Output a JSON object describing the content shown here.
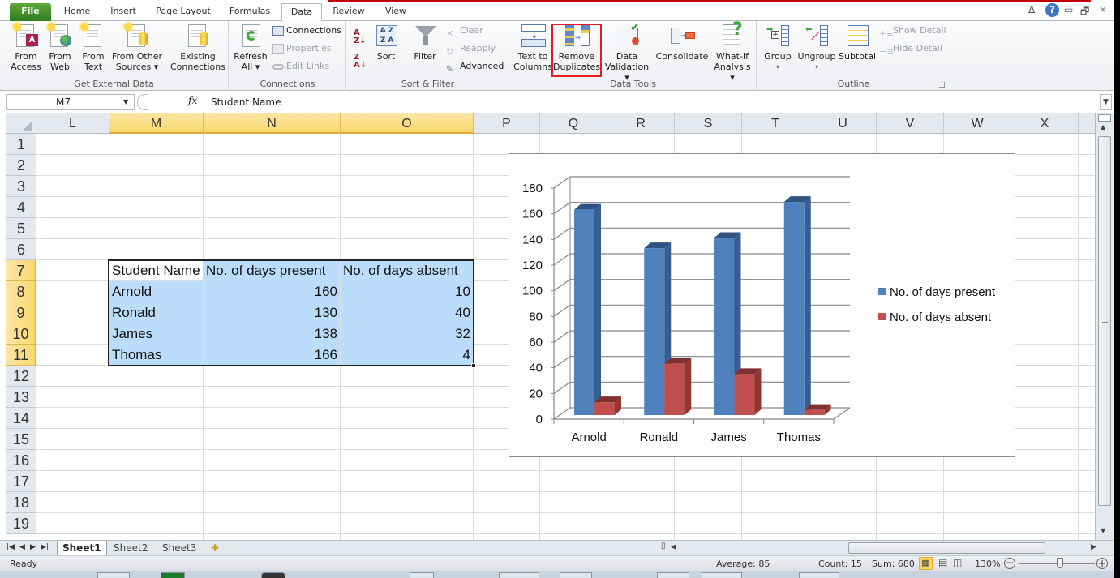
{
  "window": {
    "minimize_icon": "▭",
    "restore_icon": "🗗",
    "close_icon": "✕",
    "collapse_ribbon_icon": "ᐃ",
    "help_icon": "?"
  },
  "tabs": [
    {
      "label": "File"
    },
    {
      "label": "Home"
    },
    {
      "label": "Insert"
    },
    {
      "label": "Page Layout"
    },
    {
      "label": "Formulas"
    },
    {
      "label": "Data",
      "active": true
    },
    {
      "label": "Review"
    },
    {
      "label": "View"
    }
  ],
  "ribbon": {
    "groups": {
      "get_external_data": {
        "label": "Get External Data",
        "from_access": [
          "From",
          "Access"
        ],
        "from_web": [
          "From",
          "Web"
        ],
        "from_text": [
          "From",
          "Text"
        ],
        "from_other_sources": [
          "From Other",
          "Sources ▾"
        ],
        "existing_connections": [
          "Existing",
          "Connections"
        ]
      },
      "connections": {
        "label": "Connections",
        "refresh_all": [
          "Refresh",
          "All ▾"
        ],
        "connections": "Connections",
        "properties": "Properties",
        "edit_links": "Edit Links"
      },
      "sort_filter": {
        "label": "Sort & Filter",
        "sort_az": "A→Z",
        "sort_za": "Z→A",
        "sort": "Sort",
        "filter": "Filter",
        "clear": "Clear",
        "reapply": "Reapply",
        "advanced": "Advanced"
      },
      "data_tools": {
        "label": "Data Tools",
        "text_to_columns": [
          "Text to",
          "Columns"
        ],
        "remove_duplicates": [
          "Remove",
          "Duplicates"
        ],
        "data_validation": [
          "Data",
          "Validation ▾"
        ],
        "consolidate": [
          "Consolidate",
          ""
        ],
        "what_if": [
          "What-If",
          "Analysis ▾"
        ]
      },
      "outline": {
        "label": "Outline",
        "group": [
          "Group",
          "▾"
        ],
        "ungroup": [
          "Ungroup",
          "▾"
        ],
        "subtotal": [
          "Subtotal",
          ""
        ],
        "show_detail": "Show Detail",
        "hide_detail": "Hide Detail"
      }
    }
  },
  "formula_bar": {
    "name_box": "M7",
    "fx": "fx",
    "value": "Student Name"
  },
  "columns": [
    "L",
    "M",
    "N",
    "O",
    "P",
    "Q",
    "R",
    "S",
    "T",
    "U",
    "V",
    "W",
    "X"
  ],
  "selected_columns": [
    "M",
    "N",
    "O"
  ],
  "rows": [
    "1",
    "2",
    "3",
    "4",
    "5",
    "6",
    "7",
    "8",
    "9",
    "10",
    "11",
    "12",
    "13",
    "14",
    "15",
    "16",
    "17",
    "18",
    "19"
  ],
  "selected_rows": [
    "7",
    "8",
    "9",
    "10",
    "11"
  ],
  "table": {
    "headers": [
      "Student Name",
      "No. of days present",
      "No. of days absent"
    ],
    "rows": [
      [
        "Arnold",
        "160",
        "10"
      ],
      [
        "Ronald",
        "130",
        "40"
      ],
      [
        "James",
        "138",
        "32"
      ],
      [
        "Thomas",
        "166",
        "4"
      ]
    ]
  },
  "chart_data": {
    "type": "bar",
    "subtype": "3d-clustered-column",
    "title": "",
    "categories": [
      "Arnold",
      "Ronald",
      "James",
      "Thomas"
    ],
    "series": [
      {
        "name": "No. of days present",
        "values": [
          160,
          130,
          138,
          166
        ],
        "color": "#4f81bd"
      },
      {
        "name": "No. of days absent",
        "values": [
          10,
          40,
          32,
          4
        ],
        "color": "#c0504d"
      }
    ],
    "xlabel": "",
    "ylabel": "",
    "ylim": [
      0,
      180
    ],
    "yticks": [
      0,
      20,
      40,
      60,
      80,
      100,
      120,
      140,
      160,
      180
    ],
    "grid": true,
    "legend": "right"
  },
  "sheets": [
    {
      "label": "Sheet1",
      "active": true
    },
    {
      "label": "Sheet2"
    },
    {
      "label": "Sheet3"
    }
  ],
  "status": {
    "ready": "Ready",
    "average": "Average: 85",
    "count": "Count: 15",
    "sum": "Sum: 680",
    "zoom": "130%"
  }
}
